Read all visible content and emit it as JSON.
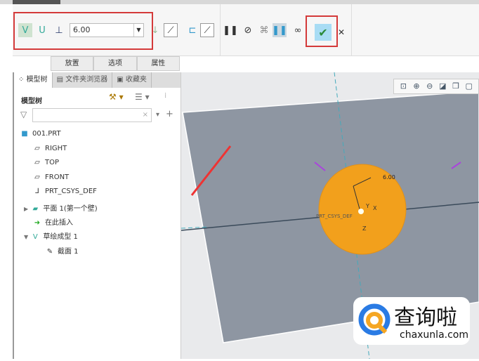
{
  "toolbar": {
    "depth_value": "6.00",
    "subtabs": [
      "放置",
      "选项",
      "属性"
    ]
  },
  "panel": {
    "tabs": [
      "模型树",
      "文件夹浏览器",
      "收藏夹"
    ],
    "header": "模型树",
    "filter_placeholder": "",
    "tree": [
      {
        "label": "001.PRT",
        "icon": "part-icon"
      },
      {
        "label": "RIGHT",
        "icon": "datum-plane-icon"
      },
      {
        "label": "TOP",
        "icon": "datum-plane-icon"
      },
      {
        "label": "FRONT",
        "icon": "datum-plane-icon"
      },
      {
        "label": "PRT_CSYS_DEF",
        "icon": "csys-icon"
      },
      {
        "label": "平面 1(第一个壁)",
        "icon": "planar-wall-icon"
      },
      {
        "label": "在此插入",
        "icon": "insert-arrow-icon"
      },
      {
        "label": "草绘成型 1",
        "icon": "sketched-form-icon"
      },
      {
        "label": "截面 1",
        "icon": "section-icon"
      }
    ]
  },
  "viewport": {
    "dimension": "6.00",
    "csys_label": "PRT_CSYS_DEF",
    "axes": [
      "Y",
      "X",
      "Z"
    ]
  },
  "watermark": {
    "name": "查询啦",
    "url": "chaxunla.com"
  },
  "colors": {
    "accent_red": "#d43a3a",
    "part_orange": "#f2a01c",
    "plane_gray": "#8e96a2"
  }
}
